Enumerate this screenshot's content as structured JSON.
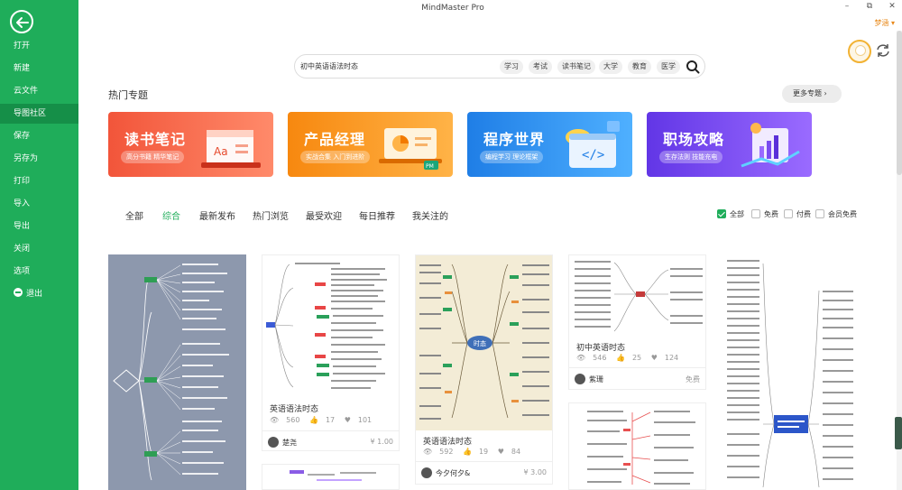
{
  "app": {
    "title": "MindMaster Pro",
    "user": "梦涵"
  },
  "sidebar": {
    "items": [
      {
        "label": "打开"
      },
      {
        "label": "新建"
      },
      {
        "label": "云文件"
      },
      {
        "label": "导图社区"
      },
      {
        "label": "保存"
      },
      {
        "label": "另存为"
      },
      {
        "label": "打印"
      },
      {
        "label": "导入"
      },
      {
        "label": "导出"
      },
      {
        "label": "关闭"
      },
      {
        "label": "选项"
      },
      {
        "label": "退出"
      }
    ],
    "active_index": 3
  },
  "search": {
    "value": "初中英语语法时态",
    "tags": [
      "学习",
      "考试",
      "读书笔记",
      "大学",
      "教育",
      "医学"
    ]
  },
  "hot": {
    "title": "热门专题",
    "more": "更多专题",
    "banners": [
      {
        "title": "读书笔记",
        "subtitle": "高分书籍 精华笔记",
        "color": "#f25a3c"
      },
      {
        "title": "产品经理",
        "subtitle": "实战合集 入门到进阶",
        "color": "#f5891f"
      },
      {
        "title": "程序世界",
        "subtitle": "编程学习 理论框架",
        "color": "#2a8de8"
      },
      {
        "title": "职场攻略",
        "subtitle": "生存法则 技能充电",
        "color": "#6a3ee6"
      }
    ]
  },
  "filters": {
    "tabs": [
      "全部",
      "综合",
      "最新发布",
      "热门浏览",
      "最受欢迎",
      "每日推荐",
      "我关注的"
    ],
    "active": 1,
    "checks": [
      {
        "label": "全部",
        "checked": true
      },
      {
        "label": "免费",
        "checked": false
      },
      {
        "label": "付费",
        "checked": false
      },
      {
        "label": "会员免费",
        "checked": false
      }
    ]
  },
  "cards": [
    {
      "title": "英语语法时态",
      "views": "560",
      "likes": "17",
      "favs": "101",
      "user": "楚尧",
      "price": "¥ 1.00"
    },
    {
      "title": "英语语法时态",
      "views": "592",
      "likes": "19",
      "favs": "84",
      "user": "今夕何夕&",
      "price": "¥ 3.00"
    },
    {
      "title": "初中英语时态",
      "views": "546",
      "likes": "25",
      "favs": "124",
      "user": "紫珊",
      "price": "免费"
    }
  ],
  "center_node": "时态"
}
